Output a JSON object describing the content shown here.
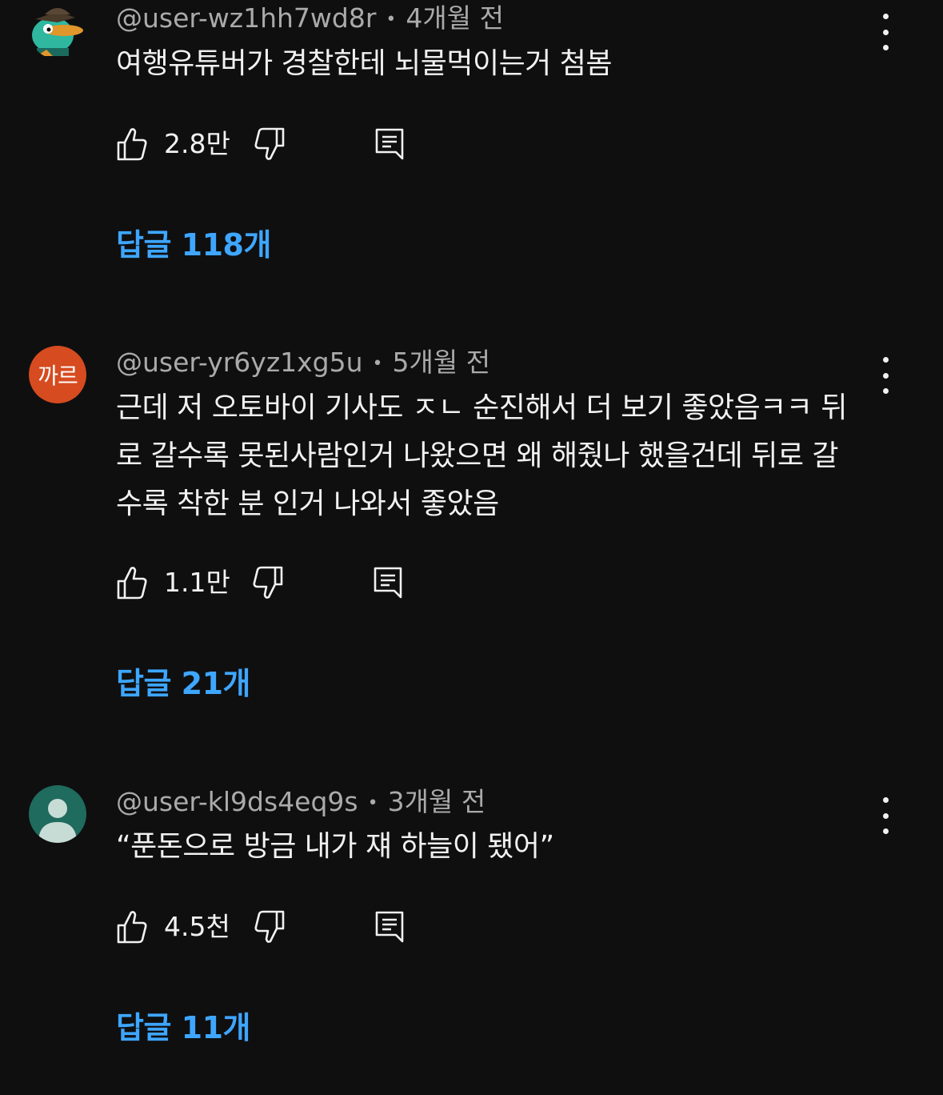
{
  "comments": [
    {
      "author": "@user-wz1hh7wd8r",
      "time": "4개월 전",
      "avatar_type": "cartoon",
      "text": "여행유튜버가 경찰한테 뇌물먹이는거 첨봄",
      "likes": "2.8만",
      "replies_label": "답글 118개"
    },
    {
      "author": "@user-yr6yz1xg5u",
      "time": "5개월 전",
      "avatar_type": "text",
      "avatar_text": "까르",
      "text": "근데 저 오토바이 기사도 ㅈㄴ 순진해서 더 보기 좋았음ㅋㅋ 뒤로 갈수록 못된사람인거 나왔으면 왜 해줬나 했을건데 뒤로 갈수록 착한 분 인거 나와서 좋았음",
      "likes": "1.1만",
      "replies_label": "답글 21개"
    },
    {
      "author": "@user-kl9ds4eq9s",
      "time": "3개월 전",
      "avatar_type": "default",
      "text": "“푼돈으로 방금 내가 쟤 하늘이 됐어”",
      "likes": "4.5천",
      "replies_label": "답글 11개"
    }
  ],
  "colors": {
    "background": "#0f0f10",
    "link": "#3ea6ff",
    "meta": "#aaaaaa",
    "text": "#f1f1f1",
    "avatar_text_bg": "#d64b1f",
    "avatar_default_bg": "#1f6b5e"
  },
  "icons": {
    "like": "thumbs-up-icon",
    "dislike": "thumbs-down-icon",
    "reply": "reply-comment-icon",
    "more": "more-vertical-icon"
  }
}
